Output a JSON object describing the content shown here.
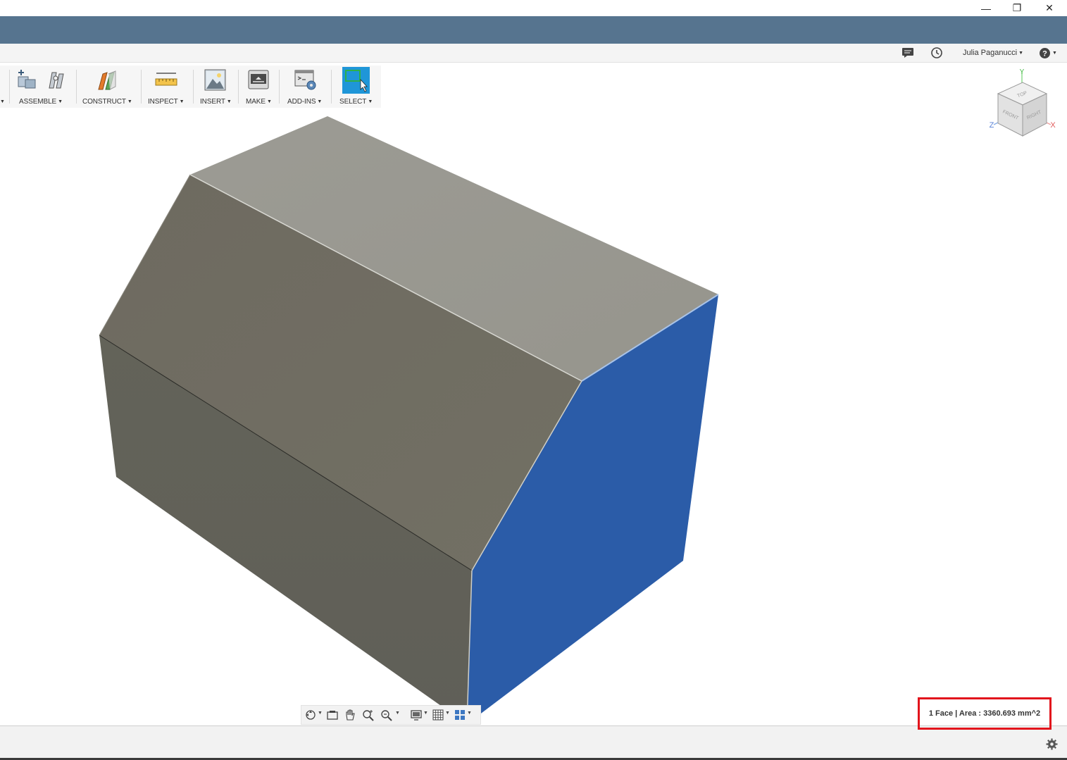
{
  "window": {
    "minimize_glyph": "—",
    "restore_glyph": "❐",
    "close_glyph": "✕"
  },
  "topbar": {
    "user_name": "Julia Paganucci",
    "icons": [
      "comment-icon",
      "job-status-icon",
      "help-icon"
    ]
  },
  "toolbar": {
    "groups": [
      {
        "label": "ASSEMBLE"
      },
      {
        "label": "CONSTRUCT"
      },
      {
        "label": "INSPECT"
      },
      {
        "label": "INSERT"
      },
      {
        "label": "MAKE"
      },
      {
        "label": "ADD-INS"
      },
      {
        "label": "SELECT"
      }
    ]
  },
  "viewcube": {
    "faces": [
      "TOP",
      "FRONT",
      "RIGHT"
    ],
    "axes": [
      "Y",
      "Z",
      "X"
    ]
  },
  "model": {
    "body_color": "#6e6a60",
    "top_color": "#9c9b94",
    "selected_face_color": "#2b5ca8"
  },
  "status": {
    "measurement": "1 Face | Area : 3360.693 mm^2"
  },
  "colors": {
    "app_band": "#56748f",
    "select_active": "#1f96d8",
    "highlight_box": "#e2141c"
  }
}
